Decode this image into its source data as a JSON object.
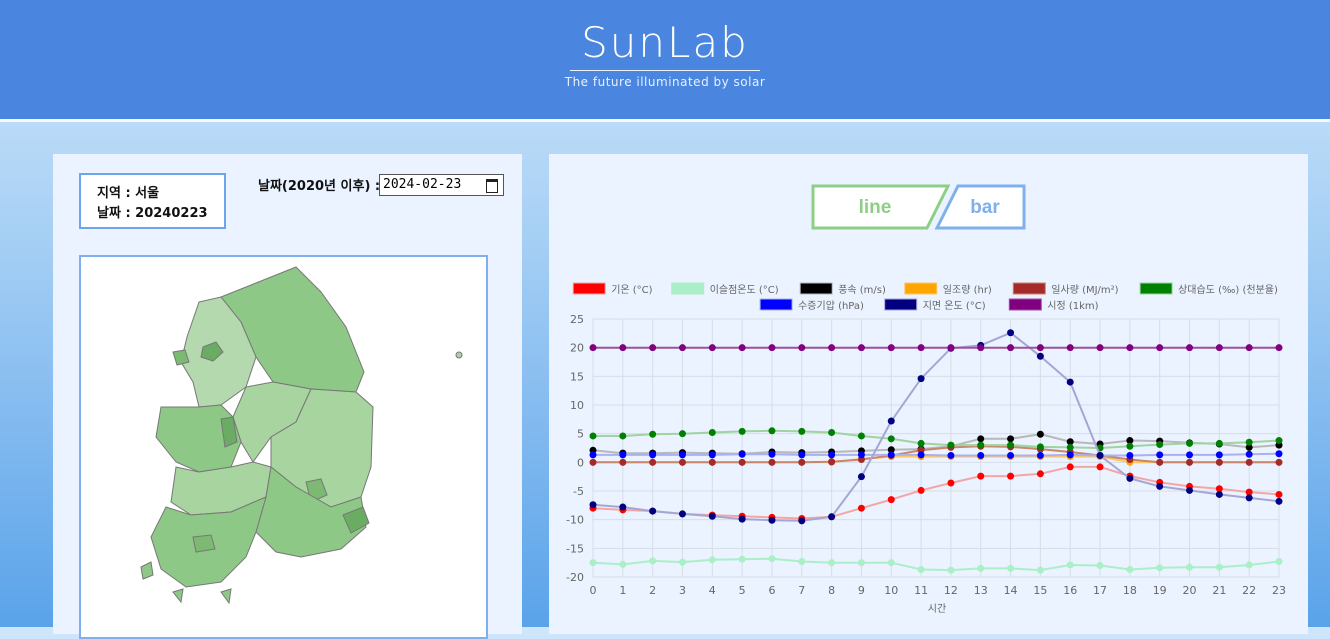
{
  "header": {
    "title": "SunLab",
    "tagline": "The future illuminated by solar"
  },
  "info": {
    "region_label": "지역 : 서울",
    "date_label": "날짜 : 20240223"
  },
  "date_picker": {
    "label": "날짜(2020년 이후) :",
    "value": "2024-02-23"
  },
  "chart_toggle": {
    "line_label": "line",
    "bar_label": "bar",
    "active": "line",
    "line_color": "#8fce86",
    "bar_color": "#7fb0ec"
  },
  "map": {
    "colors": [
      "#b5d9ae",
      "#8ec887",
      "#a7d49f",
      "#7cba74",
      "#6aad62"
    ]
  },
  "chart_data": {
    "type": "line",
    "x": [
      0,
      1,
      2,
      3,
      4,
      5,
      6,
      7,
      8,
      9,
      10,
      11,
      12,
      13,
      14,
      15,
      16,
      17,
      18,
      19,
      20,
      21,
      22,
      23
    ],
    "xlabel": "시간",
    "ylabel": "",
    "ylim": [
      -20,
      25
    ],
    "yticks": [
      25,
      20,
      15,
      10,
      5,
      0,
      -5,
      -10,
      -15,
      -20
    ],
    "grid": true,
    "legend_position": "top",
    "series": [
      {
        "name": "기온 (°C)",
        "color": "#ff0000",
        "line": "#f4a6a6",
        "values": [
          -8,
          -8.3,
          -8.5,
          -9,
          -9.2,
          -9.4,
          -9.6,
          -9.8,
          -9.5,
          -8,
          -6.5,
          -4.9,
          -3.6,
          -2.4,
          -2.4,
          -2,
          -0.8,
          -0.8,
          -2.4,
          -3.5,
          -4.2,
          -4.6,
          -5.2,
          -5.6
        ]
      },
      {
        "name": "이슬점온도 (°C)",
        "color": "#abefc7",
        "line": "#abefc7",
        "values": [
          -17.5,
          -17.8,
          -17.2,
          -17.4,
          -17,
          -16.9,
          -16.8,
          -17.3,
          -17.5,
          -17.5,
          -17.5,
          -18.7,
          -18.8,
          -18.5,
          -18.5,
          -18.8,
          -17.9,
          -18,
          -18.7,
          -18.4,
          -18.3,
          -18.3,
          -17.9,
          -17.3
        ]
      },
      {
        "name": "풍속 (m/s)",
        "color": "#000000",
        "line": "#b8b8b8",
        "values": [
          2.1,
          1.6,
          1.6,
          1.7,
          1.6,
          1.5,
          1.8,
          1.7,
          1.8,
          2,
          2.2,
          2.3,
          2.8,
          4.1,
          4.1,
          4.9,
          3.6,
          3.2,
          3.8,
          3.7,
          3.4,
          3.2,
          2.6,
          3
        ]
      },
      {
        "name": "일조량 (hr)",
        "color": "#ffa500",
        "line": "#ffc766",
        "values": [
          0,
          0,
          0,
          0,
          0,
          0,
          0,
          0,
          0,
          0.6,
          1,
          1,
          1,
          1,
          1,
          1,
          1,
          1,
          0,
          0,
          0,
          0,
          0,
          0
        ]
      },
      {
        "name": "일사량 (MJ/m²)",
        "color": "#a52a2a",
        "line": "#c9866b",
        "values": [
          0,
          0,
          0,
          0,
          0,
          0,
          0,
          0,
          0.1,
          0.5,
          1.2,
          2.1,
          2.6,
          2.8,
          2.7,
          2.3,
          1.8,
          1.2,
          0.5,
          0,
          0,
          0,
          0,
          0
        ]
      },
      {
        "name": "상대습도 (‰) (천분율)",
        "color": "#008000",
        "line": "#9fd39f",
        "values": [
          4.6,
          4.6,
          4.9,
          5,
          5.2,
          5.4,
          5.5,
          5.4,
          5.2,
          4.6,
          4.1,
          3.3,
          3,
          3,
          3,
          2.7,
          2.6,
          2.5,
          2.8,
          3.1,
          3.3,
          3.3,
          3.5,
          3.8
        ]
      },
      {
        "name": "수증기압 (hPa)",
        "color": "#0000ff",
        "line": "#aab0f0",
        "values": [
          1.3,
          1.3,
          1.3,
          1.3,
          1.3,
          1.4,
          1.4,
          1.3,
          1.3,
          1.3,
          1.3,
          1.3,
          1.2,
          1.2,
          1.2,
          1.2,
          1.3,
          1.2,
          1.2,
          1.3,
          1.3,
          1.3,
          1.4,
          1.5
        ]
      },
      {
        "name": "지면 온도 (°C)",
        "color": "#000080",
        "line": "#a6a6d4",
        "values": [
          -7.4,
          -7.8,
          -8.5,
          -9,
          -9.4,
          -9.9,
          -10.1,
          -10.2,
          -9.5,
          -2.5,
          7.2,
          14.6,
          19.9,
          20.4,
          22.6,
          18.5,
          14,
          1.2,
          -2.8,
          -4.2,
          -4.9,
          -5.6,
          -6.2,
          -6.8
        ]
      },
      {
        "name": "시정 (1km)",
        "color": "#800080",
        "line": "#9e4f9e",
        "values": [
          20,
          20,
          20,
          20,
          20,
          20,
          20,
          20,
          20,
          20,
          20,
          20,
          20,
          20,
          20,
          20,
          20,
          20,
          20,
          20,
          20,
          20,
          20,
          20
        ]
      }
    ]
  }
}
